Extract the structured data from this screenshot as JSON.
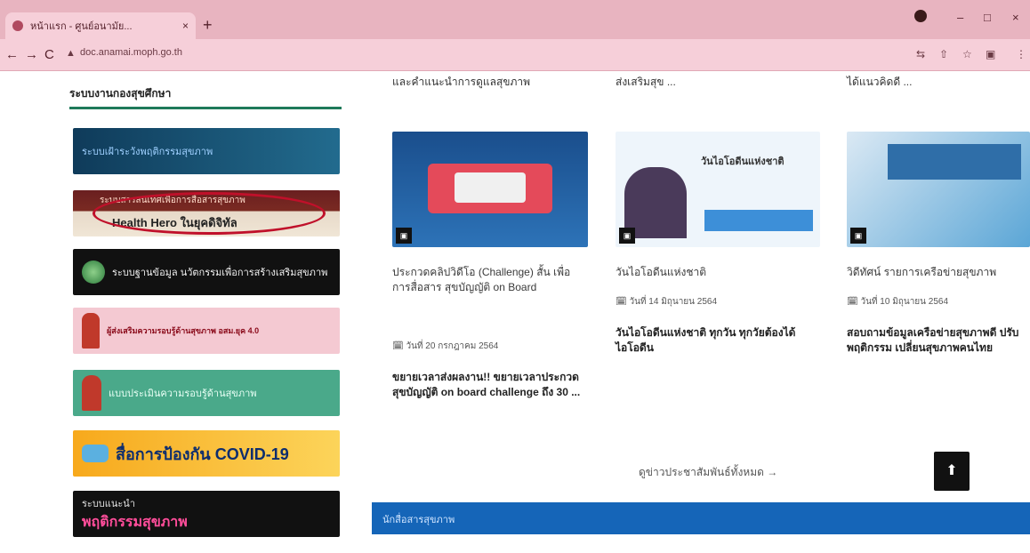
{
  "browser": {
    "tab_title": "หน้าแรก - ศูนย์อนามัย...",
    "new_tab": "+",
    "tab_close": "×",
    "url": "doc.anamai.moph.go.th",
    "win_min": "–",
    "win_max": "□",
    "win_close": "×",
    "back": "←",
    "forward": "→",
    "reload": "C",
    "lock": "▲"
  },
  "sidebar": {
    "title": "ระบบงานกองสุขศึกษา",
    "banners": [
      {
        "text": "ระบบเฝ้าระวังพฤติกรรมสุขภาพ"
      },
      {
        "line1": "ระบบสารสนเทศเพื่อการสื่อสารสุขภาพ",
        "line2": "Health Hero ในยุคดิจิทัล"
      },
      {
        "text": "ระบบฐานข้อมูล นวัตกรรมเพื่อการสร้างเสริมสุขภาพ"
      },
      {
        "text": "ผู้ส่งเสริมความรอบรู้ด้านสุขภาพ อสม.ยุค 4.0"
      },
      {
        "text": "แบบประเมินความรอบรู้ด้านสุขภาพ"
      },
      {
        "text": "สื่อการป้องกัน COVID-19"
      },
      {
        "small": "ระบบแนะนำ",
        "big": "พฤติกรรมสุขภาพ"
      }
    ]
  },
  "news": {
    "top_snippets": [
      "และคำแนะนำการดูแลสุขภาพ",
      "ส่งเสริมสุข ...",
      "ได้แนวคิดดี ..."
    ],
    "items": [
      {
        "headline": "ประกวดคลิปวิดีโอ (Challenge) สั้น เพื่อการสื่อสาร สุขบัญญัติ on Board",
        "date": "วันที่ 20 กรกฎาคม 2564",
        "summary": "ขยายเวลาส่งผลงาน!! ขยายเวลาประกวดสุขบัญญัติ on board challenge ถึง 30 ..."
      },
      {
        "headline": "วันไอโอดีนแห่งชาติ",
        "date": "วันที่ 14 มิถุนายน 2564",
        "summary": "วันไอโอดีนแห่งชาติ ทุกวัน ทุกวัยต้องได้ไอโอดีน",
        "thumb_label": "วันไอโอดีนแห่งชาติ"
      },
      {
        "headline": "วิดีทัศน์ รายการเครือข่ายสุขภาพ",
        "date": "วันที่ 10 มิถุนายน 2564",
        "summary": "สอบถามข้อมูลเครือข่ายสุขภาพดี ปรับพฤติกรรม เปลี่ยนสุขภาพคนไทย"
      }
    ],
    "more_link": "ดูข่าวประชาสัมพันธ์ทั้งหมด →"
  },
  "footer_bar": "นักสื่อสารสุขภาพ",
  "back_to_top": "⬆"
}
